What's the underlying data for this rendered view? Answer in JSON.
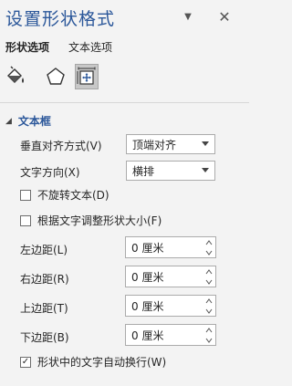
{
  "header": {
    "title": "设置形状格式",
    "menu_glyph": "▼",
    "close_glyph": "✕"
  },
  "tabs": [
    {
      "label": "形状选项",
      "active": true
    },
    {
      "label": "文本选项",
      "active": false
    }
  ],
  "icons": [
    {
      "name": "fill-line-icon",
      "active": false
    },
    {
      "name": "effects-icon",
      "active": false
    },
    {
      "name": "size-properties-icon",
      "active": true
    }
  ],
  "section": {
    "title": "文本框",
    "expanded": true
  },
  "fields": {
    "vertical_align": {
      "label": "垂直对齐方式(V)",
      "value": "顶端对齐"
    },
    "text_direction": {
      "label": "文字方向(X)",
      "value": "横排"
    },
    "no_rotate": {
      "label": "不旋转文本(D)",
      "checked": false
    },
    "resize_shape": {
      "label": "根据文字调整形状大小(F)",
      "checked": false
    },
    "left_margin": {
      "label": "左边距(L)",
      "value": "0 厘米"
    },
    "right_margin": {
      "label": "右边距(R)",
      "value": "0 厘米"
    },
    "top_margin": {
      "label": "上边距(T)",
      "value": "0 厘米"
    },
    "bottom_margin": {
      "label": "下边距(B)",
      "value": "0 厘米"
    },
    "wrap_text": {
      "label": "形状中的文字自动换行(W)",
      "checked": true
    }
  },
  "colors": {
    "accent": "#2b579a",
    "panel_bg": "#f3f3f3",
    "active_icon_bg": "#c8c8c8"
  }
}
